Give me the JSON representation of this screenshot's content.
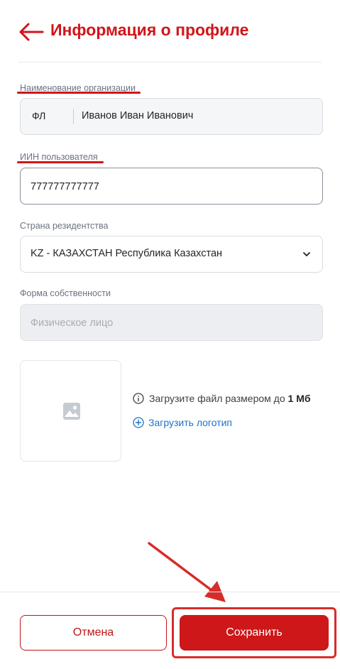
{
  "header": {
    "title": "Информация о профиле",
    "back_icon": "arrow-left-icon",
    "accent_color": "#d0161b"
  },
  "form": {
    "organization": {
      "label": "Наименование организации",
      "prefix": "ФЛ",
      "value": "Иванов Иван Иванович"
    },
    "iin": {
      "label": "ИИН пользователя",
      "value": "777777777777"
    },
    "country": {
      "label": "Страна резидентства",
      "selected": "KZ - КАЗАХСТАН Республика Казахстан"
    },
    "ownership": {
      "label": "Форма собственности",
      "placeholder": "Физическое лицо"
    }
  },
  "logo": {
    "placeholder_icon": "image-icon",
    "hint_prefix": "Загрузите файл размером до",
    "hint_size": "1 Мб",
    "upload_label": "Загрузить логотип",
    "upload_icon": "plus-circle-icon",
    "link_color": "#1e73c8"
  },
  "footer": {
    "cancel_label": "Отмена",
    "save_label": "Сохранить",
    "primary_color": "#cd1719"
  },
  "annotations": {
    "color": "#d62d2b"
  }
}
